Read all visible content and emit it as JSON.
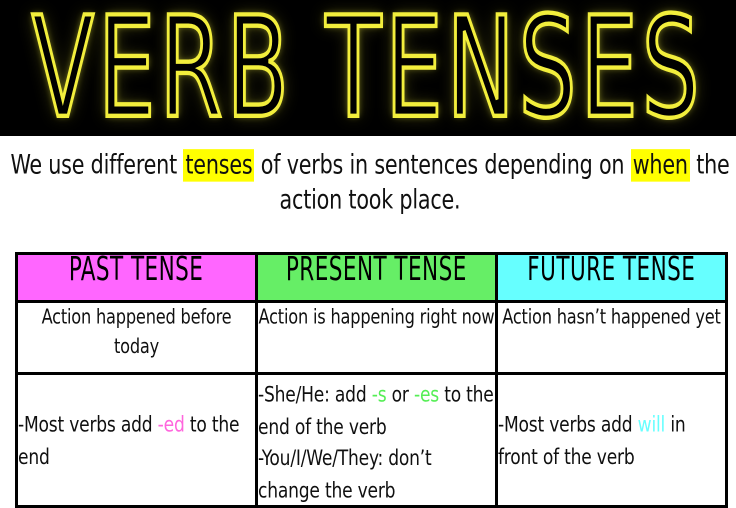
{
  "banner": {
    "title": "VERB TENSES",
    "background_color": "#000000",
    "title_color": "#f2ee3c"
  },
  "intro": {
    "line1_part1": "We use different ",
    "line1_highlight1": "tenses",
    "line1_part2": " of verbs in sentences depending on ",
    "line1_highlight2": "when",
    "line2": "the action took place.",
    "highlight_color": "#ffff00"
  },
  "table": {
    "columns": [
      {
        "header": "PAST TENSE",
        "header_color": "#ff66ff",
        "definition": "Action happened before today",
        "rule_lines": [
          {
            "parts": [
              {
                "text": "-Most verbs add ",
                "accent": false
              },
              {
                "text": "-ed",
                "accent": true
              },
              {
                "text": " to the end",
                "accent": false
              }
            ]
          }
        ],
        "accent_color": "#ff66dd"
      },
      {
        "header": "PRESENT TENSE",
        "header_color": "#66ee66",
        "definition": "Action is happening right now",
        "rule_lines": [
          {
            "parts": [
              {
                "text": "-She/He: add ",
                "accent": false
              },
              {
                "text": "-s",
                "accent": true
              },
              {
                "text": " or ",
                "accent": false
              },
              {
                "text": "-es",
                "accent": true
              },
              {
                "text": " to the end of the verb",
                "accent": false
              }
            ]
          },
          {
            "parts": [
              {
                "text": "-You/I/We/They: don’t change the verb",
                "accent": false
              }
            ]
          }
        ],
        "accent_color": "#55ee55"
      },
      {
        "header": "FUTURE TENSE",
        "header_color": "#66ffff",
        "definition": "Action hasn’t happened yet",
        "rule_lines": [
          {
            "parts": [
              {
                "text": "-Most verbs add ",
                "accent": false
              },
              {
                "text": "will",
                "accent": true
              },
              {
                "text": " in front of the verb",
                "accent": false
              }
            ]
          }
        ],
        "accent_color": "#66ffff"
      }
    ]
  }
}
